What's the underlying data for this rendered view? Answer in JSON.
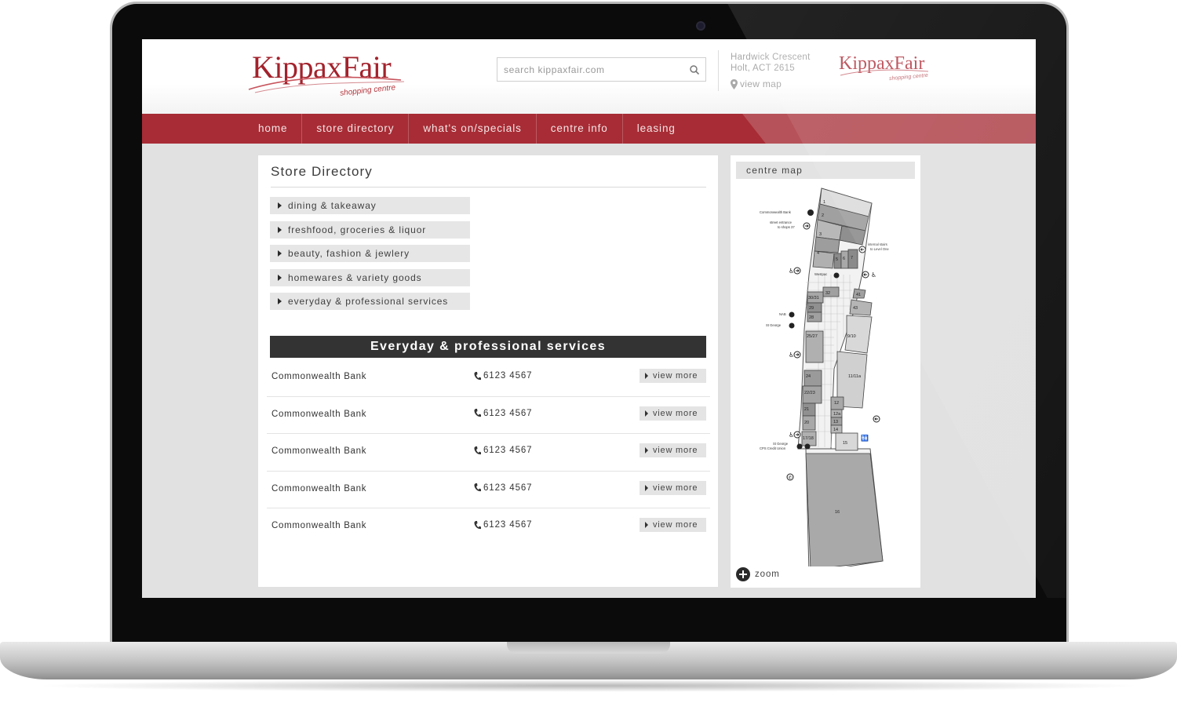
{
  "header": {
    "logo_text": "KippaxFair",
    "logo_sub": "shopping centre",
    "search_placeholder": "search kippaxfair.com",
    "address_line1": "Hardwick Crescent",
    "address_line2": "Holt, ACT 2615",
    "view_map": "view map",
    "logo2_text": "KippaxFair",
    "logo2_sub": "shopping centre"
  },
  "nav": {
    "items": [
      "home",
      "store directory",
      "what's on/specials",
      "centre info",
      "leasing"
    ]
  },
  "directory": {
    "title": "Store Directory",
    "categories": [
      "dining & takeaway",
      "freshfood, groceries & liquor",
      "beauty, fashion & jewlery",
      "homewares & variety goods",
      "everyday & professional services"
    ],
    "section_title": "Everyday & professional services",
    "stores": [
      {
        "name": "Commonwealth Bank",
        "phone": "6123 4567",
        "action": "view more"
      },
      {
        "name": "Commonwealth Bank",
        "phone": "6123 4567",
        "action": "view more"
      },
      {
        "name": "Commonwealth Bank",
        "phone": "6123 4567",
        "action": "view more"
      },
      {
        "name": "Commonwealth Bank",
        "phone": "6123 4567",
        "action": "view more"
      },
      {
        "name": "Commonwealth Bank",
        "phone": "6123 4567",
        "action": "view more"
      }
    ]
  },
  "centre_map": {
    "title": "centre map",
    "zoom_label": "zoom",
    "labels": {
      "commonwealth_bank": "Commonwealth Bank",
      "street_entrance_1": "street entrance",
      "street_entrance_2": "to shops 37",
      "internal_stairs_1": "internal stairs",
      "internal_stairs_2": "to Level One",
      "westpac": "Westpac",
      "nab": "NAB",
      "st_george": "St George",
      "st_george_2": "St George",
      "cps": "CPS Credit Union"
    },
    "shop_numbers": [
      "1",
      "2",
      "3",
      "4",
      "5",
      "6",
      "7",
      "32",
      "30/31",
      "29",
      "28",
      "25/27",
      "24",
      "22/23",
      "21",
      "20",
      "17/18",
      "41",
      "43",
      "9/10",
      "11/11a",
      "12",
      "12a",
      "13",
      "14",
      "15",
      "16"
    ]
  },
  "colors": {
    "brand": "#a72c35",
    "section_bar": "#333333"
  }
}
